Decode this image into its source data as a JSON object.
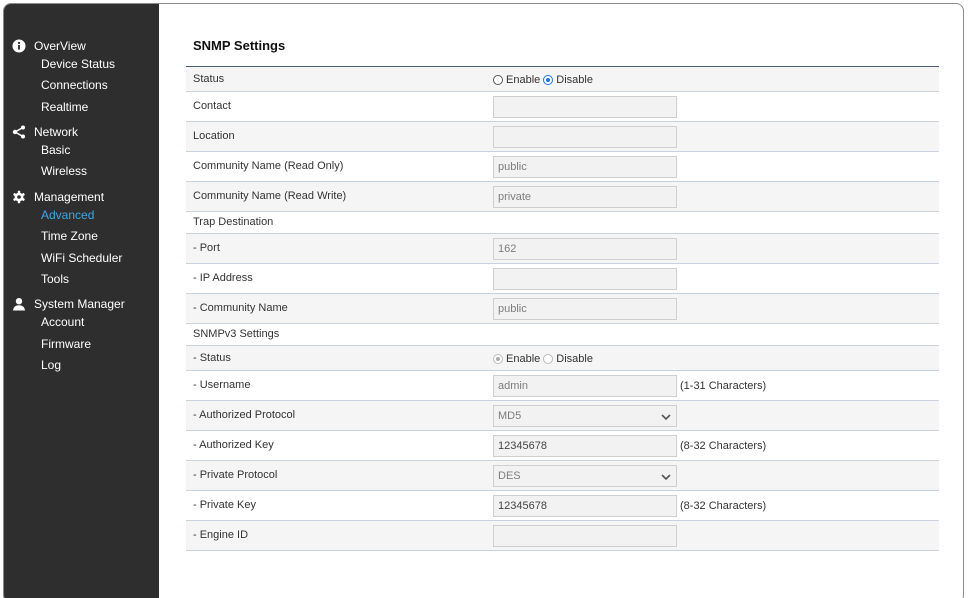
{
  "sidebar": {
    "groups": [
      {
        "label": "OverView",
        "icon": "info-icon",
        "items": [
          "Device Status",
          "Connections",
          "Realtime"
        ]
      },
      {
        "label": "Network",
        "icon": "share-network-icon",
        "items": [
          "Basic",
          "Wireless"
        ]
      },
      {
        "label": "Management",
        "icon": "gear-icon",
        "items": [
          "Advanced",
          "Time Zone",
          "WiFi Scheduler",
          "Tools"
        ]
      },
      {
        "label": "System Manager",
        "icon": "user-icon",
        "items": [
          "Account",
          "Firmware",
          "Log"
        ]
      }
    ],
    "active_item": "Advanced",
    "active_color": "#3ea7e8"
  },
  "main": {
    "title": "SNMP Settings",
    "status": {
      "label": "Status",
      "enable": "Enable",
      "disable": "Disable",
      "selected": "Disable"
    },
    "contact": {
      "label": "Contact",
      "value": ""
    },
    "location": {
      "label": "Location",
      "value": ""
    },
    "community_ro": {
      "label": "Community Name (Read Only)",
      "value": "public"
    },
    "community_rw": {
      "label": "Community Name (Read Write)",
      "value": "private"
    },
    "trap": {
      "header": "Trap Destination",
      "port": {
        "label": "- Port",
        "value": "162"
      },
      "ip": {
        "label": "- IP Address",
        "value": ""
      },
      "community": {
        "label": "- Community Name",
        "value": "public"
      }
    },
    "v3": {
      "header": "SNMPv3 Settings",
      "status": {
        "label": "- Status",
        "enable": "Enable",
        "disable": "Disable",
        "selected": "Enable"
      },
      "username": {
        "label": "- Username",
        "value": "admin",
        "hint": "(1-31 Characters)"
      },
      "auth_protocol": {
        "label": "- Authorized Protocol",
        "value": "MD5"
      },
      "auth_key": {
        "label": "- Authorized Key",
        "value": "12345678",
        "hint": "(8-32 Characters)"
      },
      "priv_protocol": {
        "label": "- Private Protocol",
        "value": "DES"
      },
      "priv_key": {
        "label": "- Private Key",
        "value": "12345678",
        "hint": "(8-32 Characters)"
      },
      "engine_id": {
        "label": "- Engine ID",
        "value": ""
      }
    }
  }
}
